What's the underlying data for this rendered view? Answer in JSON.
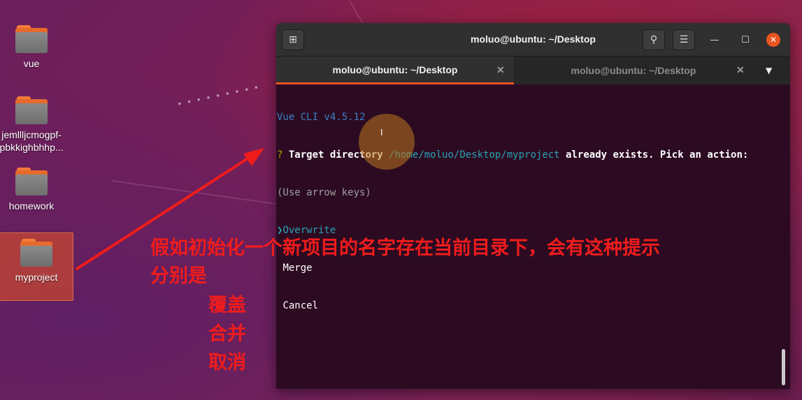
{
  "desktop": {
    "icons": [
      {
        "label": "vue"
      },
      {
        "label": "jemllljcmogpf-\npbkkighbhhp..."
      },
      {
        "label": "homework"
      },
      {
        "label": "myproject"
      }
    ]
  },
  "terminal": {
    "title": "moluo@ubuntu: ~/Desktop",
    "tabs": [
      {
        "label": "moluo@ubuntu: ~/Desktop",
        "active": true
      },
      {
        "label": "moluo@ubuntu: ~/Desktop",
        "active": false
      }
    ],
    "lines": {
      "version": "Vue CLI v4.5.12",
      "q_mark": "?",
      "q_text": "Target directory",
      "q_path": "/home/moluo/Desktop/myproject",
      "q_tail": "already exists. Pick an action:",
      "hint": "(Use arrow keys)",
      "pointer": "❯",
      "options": [
        "Overwrite",
        "Merge",
        "Cancel"
      ]
    }
  },
  "annotation": {
    "line1": "假如初始化一个新项目的名字存在当前目录下，会有这种提示",
    "line2": "分别是",
    "options": [
      "覆盖",
      "合并",
      "取消"
    ],
    "color": "#f01c1c"
  },
  "colors": {
    "accent": "#e95420"
  }
}
